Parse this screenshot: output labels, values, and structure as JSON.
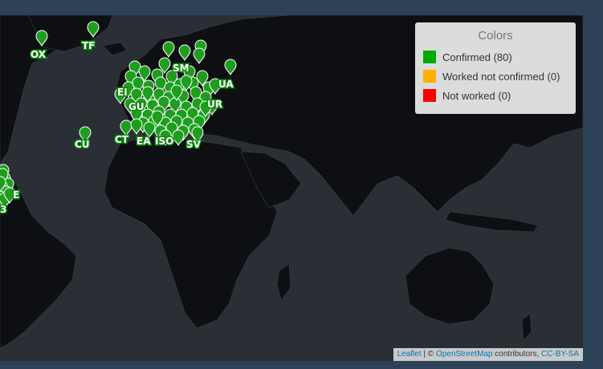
{
  "legend": {
    "title": "Colors",
    "items": [
      {
        "label": "Confirmed (80)",
        "color": "#00aa00"
      },
      {
        "label": "Worked not confirmed (0)",
        "color": "#ffb000"
      },
      {
        "label": "Not worked (0)",
        "color": "#ff0000"
      }
    ]
  },
  "attribution": {
    "leaflet": "Leaflet",
    "sep": " | © ",
    "osm": "OpenStreetMap",
    "contributors": " contributors, ",
    "license": "CC-BY-SA"
  },
  "labels": [
    {
      "text": "OX"
    },
    {
      "text": "TF"
    },
    {
      "text": "SM"
    },
    {
      "text": "UA"
    },
    {
      "text": "EI"
    },
    {
      "text": "GU"
    },
    {
      "text": "UR"
    },
    {
      "text": "CU"
    },
    {
      "text": "CT"
    },
    {
      "text": "EA"
    },
    {
      "text": "ISO"
    },
    {
      "text": "SV"
    },
    {
      "text": "E"
    },
    {
      "text": "3"
    }
  ],
  "colors": {
    "marker": "#1d9e1d",
    "land": "#0d0f12",
    "water": "#2a2f36"
  }
}
